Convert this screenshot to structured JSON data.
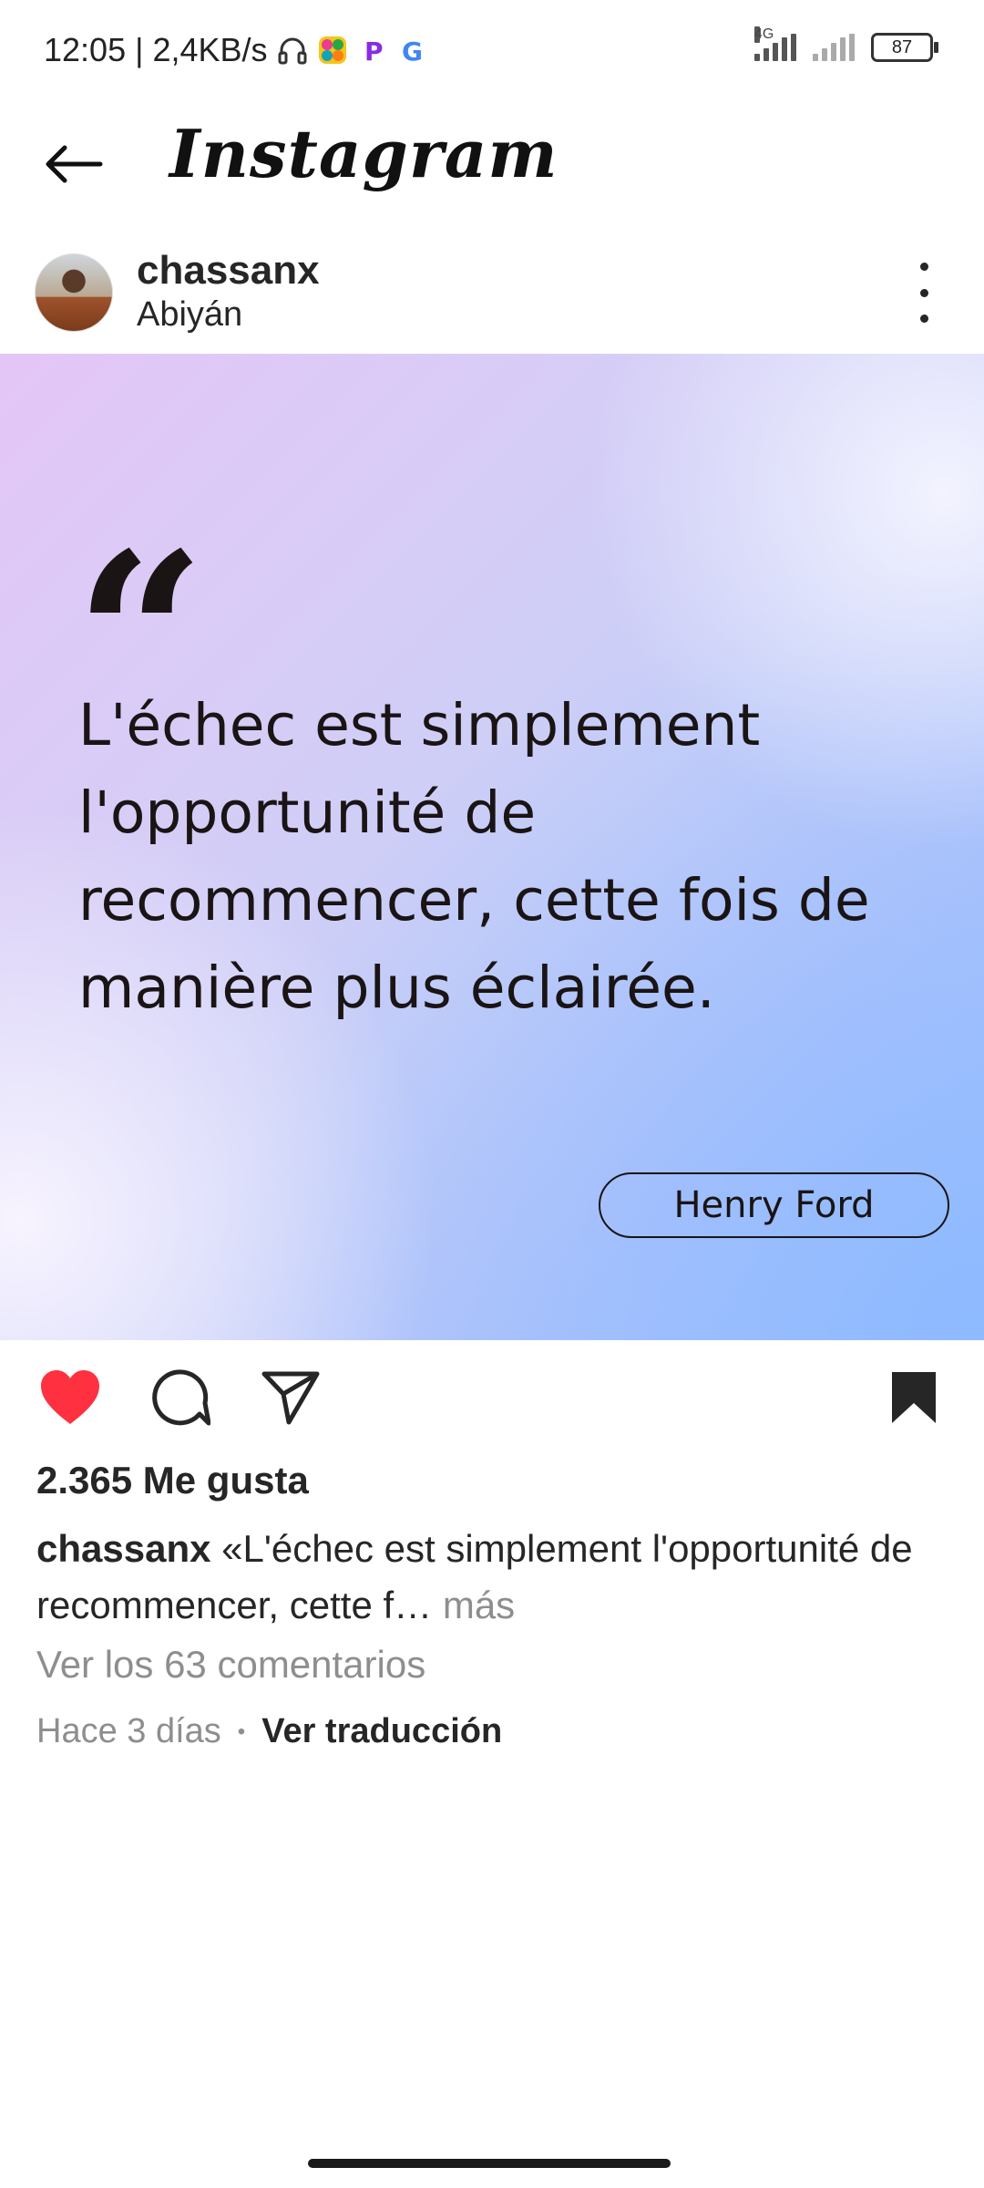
{
  "status_bar": {
    "time_speed": "12:05 | 2,4KB/s",
    "network_label": "4G",
    "battery": "87",
    "icons": [
      "headphones-icon",
      "app-icon-colorful",
      "app-icon-p",
      "google-icon",
      "signal-4g-icon",
      "signal-icon",
      "battery-icon"
    ]
  },
  "header": {
    "title": "Instagram",
    "back_icon": "arrow-left-icon"
  },
  "post": {
    "username": "chassanx",
    "location": "Abiyán",
    "more_icon": "more-vertical-icon",
    "image": {
      "quote_mark": "“",
      "quote": "L'échec est simplement l'opportunité de recommencer, cette fois de manière plus éclairée.",
      "author": "Henry Ford",
      "gradient_colors": [
        "#e4c6f6",
        "#c7cef8",
        "#9ec2ff"
      ]
    },
    "actions": {
      "like_icon": "heart-filled-icon",
      "comment_icon": "comment-icon",
      "share_icon": "send-icon",
      "save_icon": "bookmark-filled-icon",
      "like_color": "#ff3040"
    },
    "likes": "2.365 Me gusta",
    "caption": {
      "user": "chassanx",
      "text": "«L'échec est simplement l'opportunité de recommencer, cette f…",
      "more": "más"
    },
    "comments_link": "Ver los 63 comentarios",
    "time": "Hace 3 días",
    "separator": "•",
    "translate": "Ver traducción"
  }
}
